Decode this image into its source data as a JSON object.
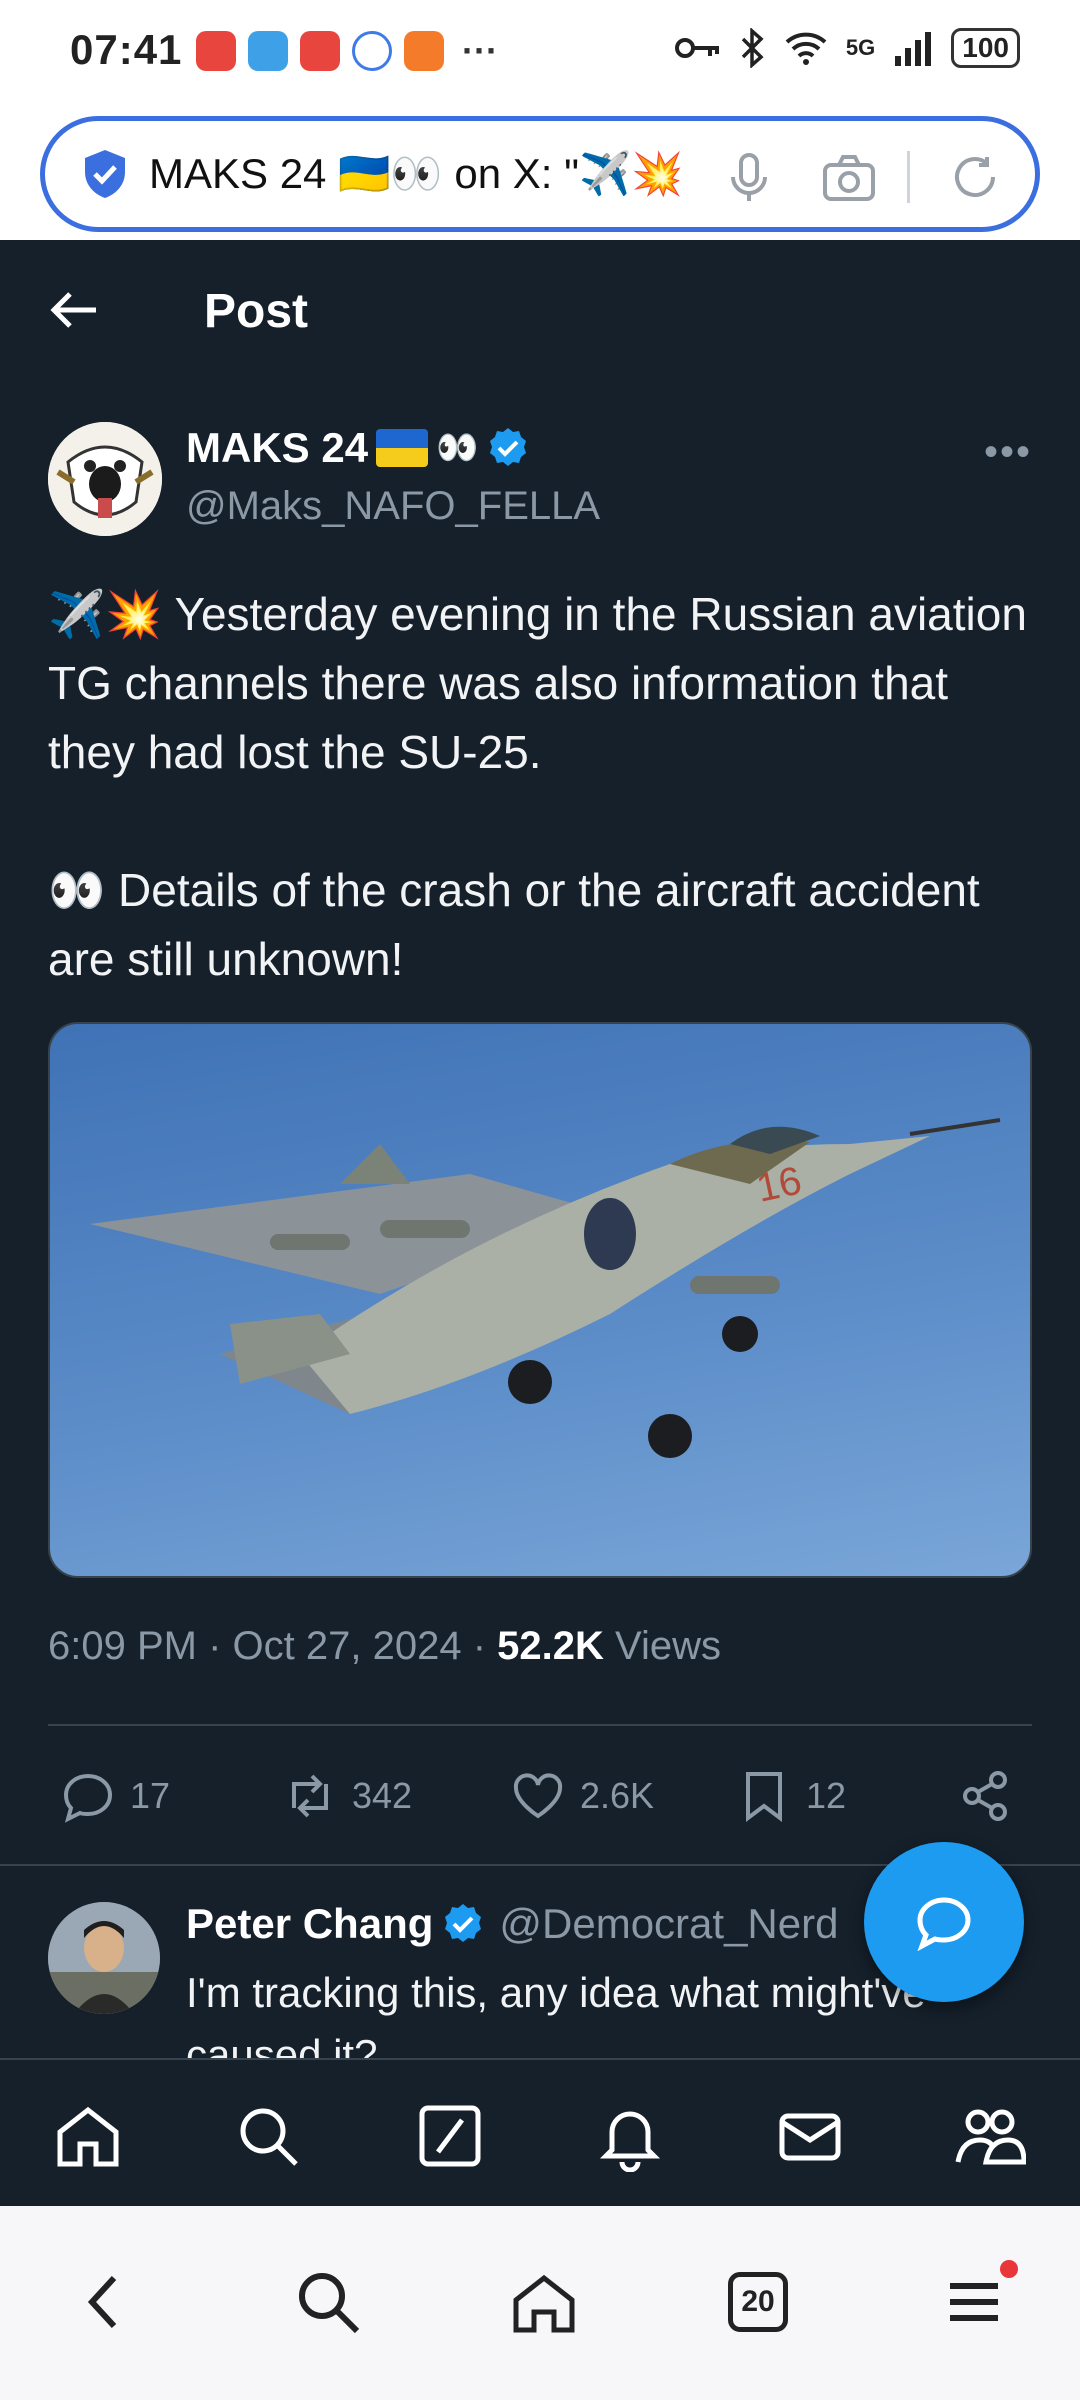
{
  "status_bar": {
    "time": "07:41",
    "more_indicator": "···",
    "network": "5G",
    "battery": "100"
  },
  "browser": {
    "url_text": "MAKS 24 🇺🇦👀 on X: \"✈️💥",
    "tab_count": "20",
    "colors": {
      "url_border": "#3b6fe0"
    }
  },
  "header": {
    "title": "Post"
  },
  "post": {
    "author_name": "MAKS 24",
    "author_emoji": "👀",
    "author_handle": "@Maks_NAFO_FELLA",
    "text": "✈️💥 Yesterday evening in the Russian aviation TG channels there was also information that they had lost the SU-25.\n\n👀 Details of the crash or the aircraft accident are still unknown!",
    "time": "6:09 PM",
    "date": "Oct 27, 2024",
    "views_count": "52.2K",
    "views_label": "Views",
    "replies": "17",
    "reposts": "342",
    "likes": "2.6K",
    "bookmarks": "12"
  },
  "reply": {
    "name": "Peter Chang",
    "handle": "@Democrat_Nerd",
    "text": "I'm tracking this, any idea what might've caused it?"
  },
  "colors": {
    "background": "#15202b",
    "accent": "#1d9bf0",
    "muted_text": "#8b98a5",
    "divider": "#38444d"
  },
  "icons": {
    "tabbar": [
      "home-icon",
      "search-icon",
      "grok-icon",
      "notifications-icon",
      "messages-icon",
      "communities-icon"
    ],
    "browser_nav": [
      "back-icon",
      "search-icon",
      "home-icon",
      "tabs-icon",
      "menu-icon"
    ]
  }
}
